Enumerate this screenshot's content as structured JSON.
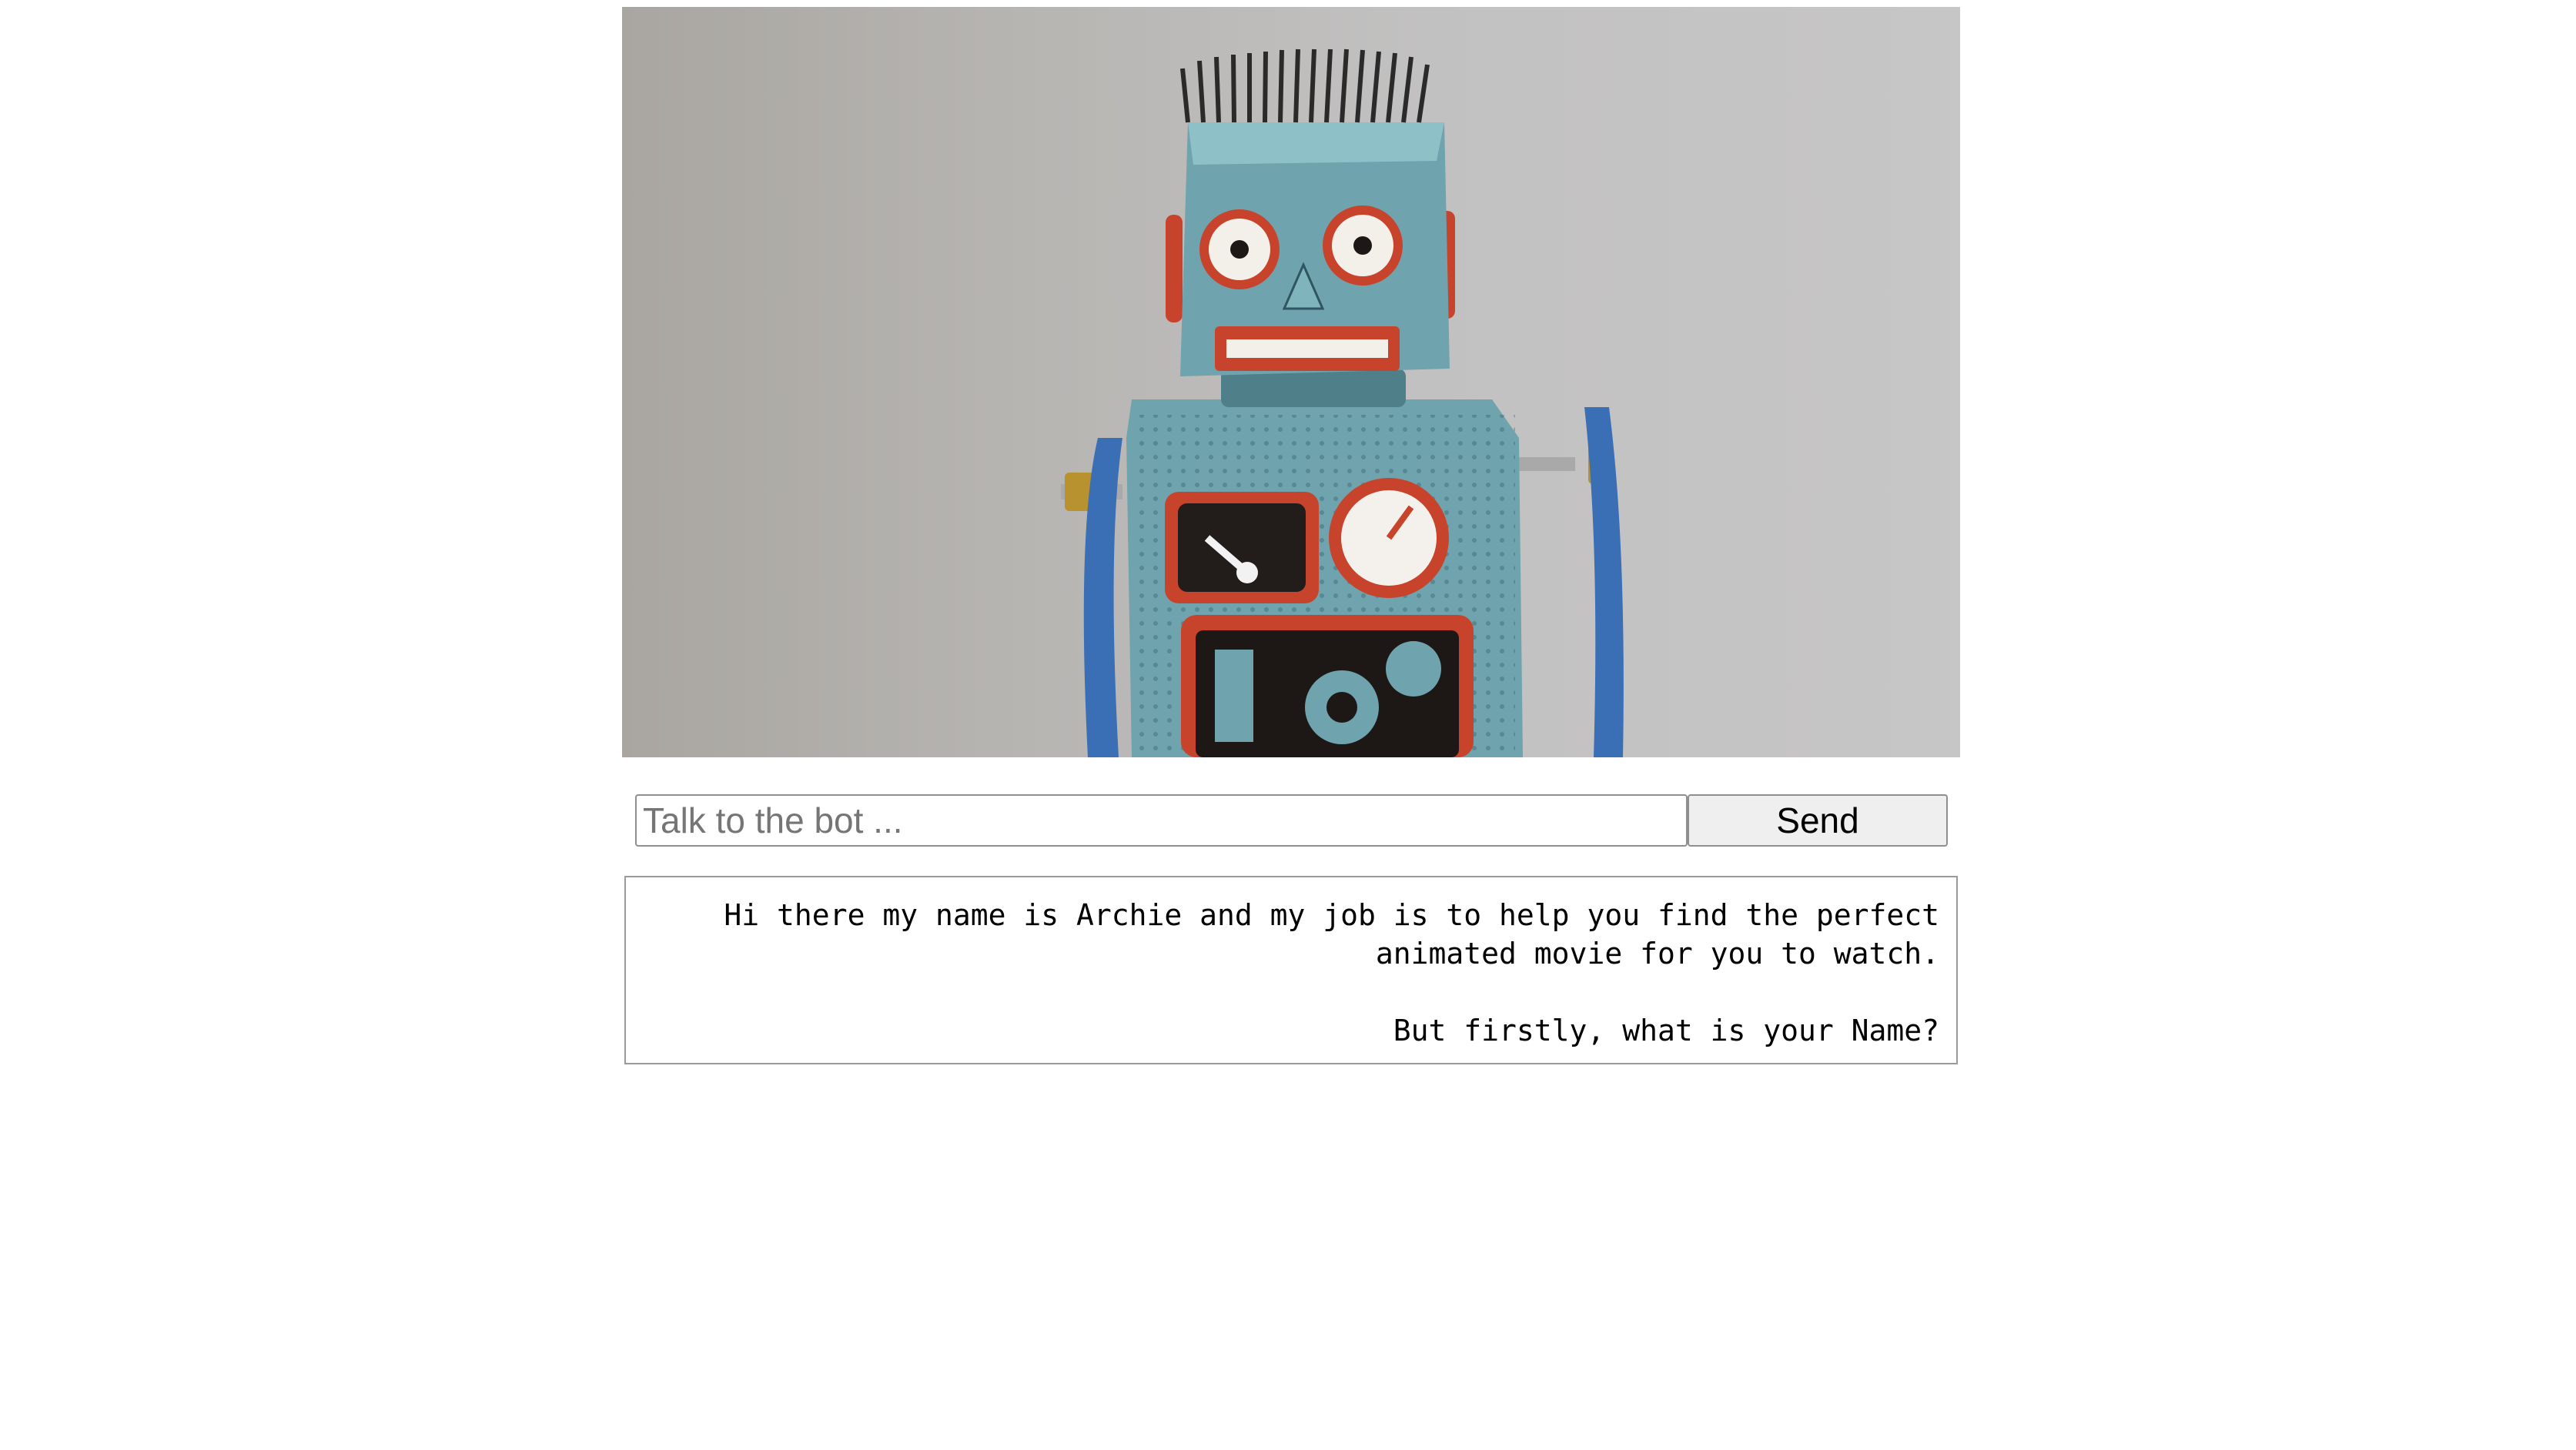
{
  "hero": {
    "image_alt": "vintage tin toy robot",
    "colors": {
      "background": "#bdbcbc",
      "robot_body": "#6fa3ad",
      "accent_red": "#c8432c",
      "arm_blue": "#3b6fb5",
      "brass": "#b8922e"
    }
  },
  "chat": {
    "input_placeholder": "Talk to the bot ...",
    "input_value": "",
    "send_label": "Send"
  },
  "response": {
    "line1": "Hi there my name is Archie and my job is to help you find the perfect",
    "line2": "animated movie for you to watch.",
    "line3": "But firstly, what is your Name?"
  }
}
